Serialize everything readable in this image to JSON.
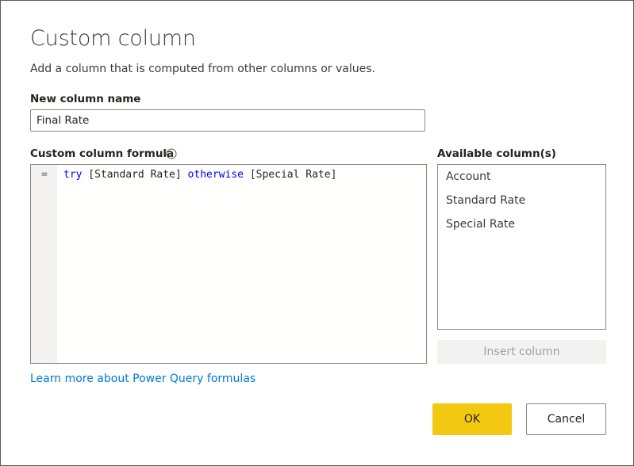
{
  "dialog": {
    "title": "Custom column",
    "subtitle": "Add a column that is computed from other columns or values."
  },
  "column_name": {
    "label": "New column name",
    "value": "Final Rate"
  },
  "formula": {
    "label": "Custom column formula",
    "info_icon": "info-circle-icon",
    "gutter_symbol": "=",
    "tokens": {
      "try": "try",
      "field1": " [Standard Rate] ",
      "otherwise": "otherwise",
      "field2": " [Special Rate]"
    },
    "keyword_color": "#0000ff"
  },
  "available_columns": {
    "label": "Available column(s)",
    "items": [
      "Account",
      "Standard Rate",
      "Special Rate"
    ],
    "insert_label": "Insert column"
  },
  "learn_more": "Learn more about Power Query formulas",
  "buttons": {
    "ok": "OK",
    "cancel": "Cancel",
    "ok_color": "#f2c811"
  }
}
